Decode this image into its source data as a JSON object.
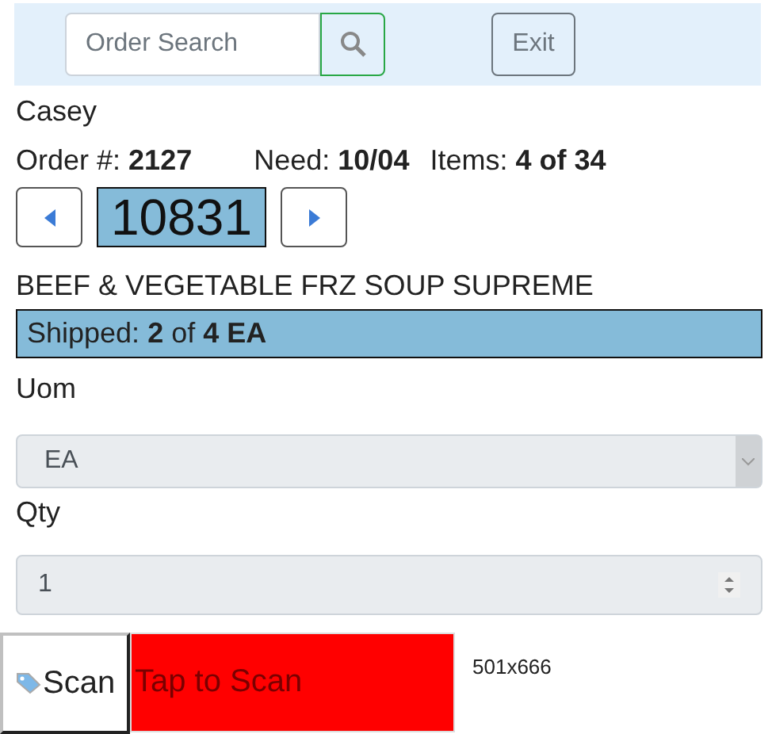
{
  "header": {
    "search": {
      "placeholder": "Order Search"
    },
    "exit_button": "Exit"
  },
  "customer": "Casey",
  "order": {
    "order_label": "Order #:",
    "order_number": "2127",
    "need_label": "Need:",
    "need_date": "10/04",
    "items_label": "Items:",
    "items_value": "4 of 34"
  },
  "item_nav": {
    "item_number": "10831"
  },
  "product_name": "BEEF & VEGETABLE FRZ SOUP SUPREME",
  "shipped": {
    "label": "Shipped:",
    "count": "2",
    "of": "of",
    "total": "4 EA"
  },
  "uom": {
    "label": "Uom",
    "value": "EA",
    "disabled": true
  },
  "qty": {
    "label": "Qty",
    "value": "1",
    "disabled": true
  },
  "scan": {
    "button": "Scan",
    "tap_area": "Tap to Scan",
    "size_text": "501x666"
  }
}
